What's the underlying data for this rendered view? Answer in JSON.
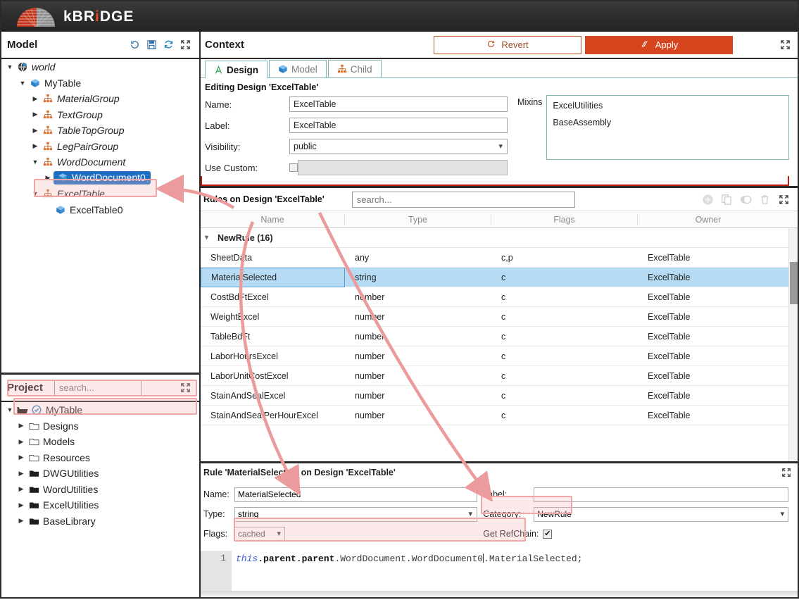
{
  "app": {
    "brand": "kBRiDGE",
    "brand_accent_letter": "i",
    "logo_icon": "bridge-arc-logo"
  },
  "colors": {
    "brand_red": "#d6451e",
    "topbar": "#2e2e2e",
    "selection_blue": "#b5dcf4",
    "tree_selection": "#1e6fc4",
    "annotation_pink": "#f0a6a6",
    "context_frame_red": "#c0190c",
    "tab_border_teal": "#7fb7b7"
  },
  "model_panel": {
    "title": "Model",
    "toolbar": [
      {
        "name": "revert-history-icon",
        "glyph": "revert"
      },
      {
        "name": "save-icon",
        "glyph": "save"
      },
      {
        "name": "refresh-icon",
        "glyph": "refresh"
      },
      {
        "name": "expand-icon",
        "glyph": "expand"
      }
    ],
    "tree": [
      {
        "label": "world",
        "depth": 0,
        "icon": "globe-icon",
        "caret": "down",
        "italic": true,
        "selected": false
      },
      {
        "label": "MyTable",
        "depth": 1,
        "icon": "cube-icon",
        "caret": "down",
        "italic": false,
        "selected": false
      },
      {
        "label": "MaterialGroup",
        "depth": 2,
        "icon": "group-icon",
        "caret": "right",
        "italic": true,
        "selected": false
      },
      {
        "label": "TextGroup",
        "depth": 2,
        "icon": "group-icon",
        "caret": "right",
        "italic": true,
        "selected": false
      },
      {
        "label": "TableTopGroup",
        "depth": 2,
        "icon": "group-icon",
        "caret": "right",
        "italic": true,
        "selected": false
      },
      {
        "label": "LegPairGroup",
        "depth": 2,
        "icon": "group-icon",
        "caret": "right",
        "italic": true,
        "selected": false
      },
      {
        "label": "WordDocument",
        "depth": 2,
        "icon": "group-icon",
        "caret": "down",
        "italic": true,
        "selected": false
      },
      {
        "label": "WordDocument0",
        "depth": 3,
        "icon": "cube-icon",
        "caret": "right",
        "italic": false,
        "selected": true
      },
      {
        "label": "ExcelTable",
        "depth": 2,
        "icon": "group-icon",
        "caret": "down",
        "italic": true,
        "selected": false
      },
      {
        "label": "ExcelTable0",
        "depth": 3,
        "icon": "cube-icon",
        "caret": "none",
        "italic": false,
        "selected": false
      }
    ]
  },
  "project_panel": {
    "title": "Project",
    "search_placeholder": "search...",
    "search_value": "",
    "expand_icon": "expand-icon",
    "tree": [
      {
        "label": "MyTable",
        "depth": 0,
        "icon": "project-open-folder-icon",
        "badge": "check-circle-icon",
        "caret": "down",
        "bold": false
      },
      {
        "label": "Designs",
        "depth": 1,
        "icon": "folder-outline-icon",
        "caret": "right"
      },
      {
        "label": "Models",
        "depth": 1,
        "icon": "folder-outline-icon",
        "caret": "right"
      },
      {
        "label": "Resources",
        "depth": 1,
        "icon": "folder-outline-icon",
        "caret": "right"
      },
      {
        "label": "DWGUtilities",
        "depth": 1,
        "icon": "folder-solid-icon",
        "caret": "right"
      },
      {
        "label": "WordUtilities",
        "depth": 1,
        "icon": "folder-solid-icon",
        "caret": "right"
      },
      {
        "label": "ExcelUtilities",
        "depth": 1,
        "icon": "folder-solid-icon",
        "caret": "right"
      },
      {
        "label": "BaseLibrary",
        "depth": 1,
        "icon": "folder-solid-icon",
        "caret": "right"
      }
    ]
  },
  "context": {
    "title": "Context",
    "revert_label": "Revert",
    "apply_label": "Apply",
    "expand_icon": "expand-icon",
    "tabs": [
      {
        "label": "Design",
        "icon": "design-a-icon",
        "active": true
      },
      {
        "label": "Model",
        "icon": "cube-icon",
        "active": false
      },
      {
        "label": "Child",
        "icon": "group-icon",
        "active": false
      }
    ],
    "editing_line": "Editing Design 'ExcelTable'",
    "fields": {
      "name_label": "Name:",
      "name_value": "ExcelTable",
      "label_label": "Label:",
      "label_value": "ExcelTable",
      "visibility_label": "Visibility:",
      "visibility_value": "public",
      "use_custom_label": "Use Custom:",
      "use_custom_checked": false,
      "use_custom_value": ""
    },
    "mixins_label": "Mixins",
    "mixins": [
      "ExcelUtilities",
      "BaseAssembly"
    ]
  },
  "rules": {
    "title": "Rules on Design 'ExcelTable'",
    "search_placeholder": "search...",
    "search_value": "",
    "toolbar": [
      {
        "name": "add-rule-icon",
        "glyph": "plus-circle",
        "disabled": true
      },
      {
        "name": "copy-rule-icon",
        "glyph": "copy",
        "disabled": true
      },
      {
        "name": "toggle-rule-icon",
        "glyph": "toggle",
        "disabled": true
      },
      {
        "name": "delete-rule-icon",
        "glyph": "trash",
        "disabled": true
      },
      {
        "name": "expand-icon",
        "glyph": "expand",
        "disabled": false
      }
    ],
    "columns": [
      "Name",
      "Type",
      "Flags",
      "Owner"
    ],
    "group": {
      "label": "NewRule (16)",
      "expanded": true
    },
    "rows": [
      {
        "name": "SheetData",
        "type": "any",
        "flags": "c,p",
        "owner": "ExcelTable",
        "selected": false
      },
      {
        "name": "MaterialSelected",
        "type": "string",
        "flags": "c",
        "owner": "ExcelTable",
        "selected": true
      },
      {
        "name": "CostBdFtExcel",
        "type": "number",
        "flags": "c",
        "owner": "ExcelTable",
        "selected": false
      },
      {
        "name": "WeightExcel",
        "type": "number",
        "flags": "c",
        "owner": "ExcelTable",
        "selected": false
      },
      {
        "name": "TableBdFt",
        "type": "number",
        "flags": "c",
        "owner": "ExcelTable",
        "selected": false
      },
      {
        "name": "LaborHoursExcel",
        "type": "number",
        "flags": "c",
        "owner": "ExcelTable",
        "selected": false
      },
      {
        "name": "LaborUnitCostExcel",
        "type": "number",
        "flags": "c",
        "owner": "ExcelTable",
        "selected": false
      },
      {
        "name": "StainAndSealExcel",
        "type": "number",
        "flags": "c",
        "owner": "ExcelTable",
        "selected": false
      },
      {
        "name": "StainAndSealPerHourExcel",
        "type": "number",
        "flags": "c",
        "owner": "ExcelTable",
        "selected": false
      }
    ]
  },
  "rule_detail": {
    "title": "Rule 'MaterialSelected' on Design 'ExcelTable'",
    "name_label": "Name:",
    "name_value": "MaterialSelected",
    "type_label": "Type:",
    "type_value": "string",
    "flags_label": "Flags:",
    "flags_value": "cached",
    "label_label": "Label:",
    "label_value": "",
    "category_label": "Category:",
    "category_value": "NewRule",
    "get_refchain_label": "Get RefChain:",
    "get_refchain_checked": true,
    "expand_icon": "expand-icon",
    "code": {
      "line_number": "1",
      "tok_this": "this",
      "tok_path_bold": ".parent.parent",
      "tok_rest": ".WordDocument.WordDocument0",
      "tok_tail": ".MaterialSelected;"
    }
  },
  "annotations": {
    "highlights": [
      "model-tree-worddocument0",
      "project-mytable",
      "project-designs",
      "get-refchain-checkbox",
      "code-line-refchain"
    ],
    "arrows": [
      {
        "name": "arrow-to-worddocument0",
        "from": "rules-panel-title",
        "to": "model-tree-worddocument0"
      },
      {
        "name": "arrow-to-code-expression",
        "from": "excel-table0-node",
        "to": "code-line-refchain"
      },
      {
        "name": "arrow-to-flags",
        "from": "rules-table",
        "to": "rule-flags-field"
      },
      {
        "name": "arrow-to-get-refchain",
        "from": "rules-table",
        "to": "get-refchain-checkbox"
      }
    ]
  }
}
